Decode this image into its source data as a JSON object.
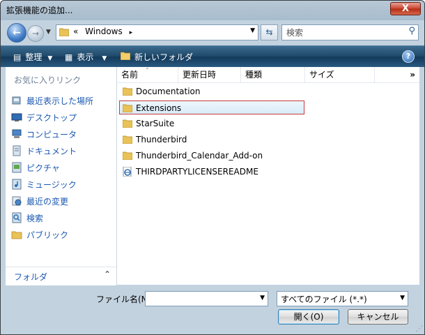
{
  "window": {
    "title": "拡張機能の追加...",
    "close_label": "X"
  },
  "address": {
    "prefix": "«",
    "crumb": "Windows",
    "sep": "▸"
  },
  "search": {
    "placeholder": "検索"
  },
  "toolbar": {
    "organize": "整理",
    "views": "表示",
    "new_folder": "新しいフォルダ",
    "help": "?"
  },
  "nav": {
    "header": "お気に入りリンク",
    "items": [
      {
        "label": "最近表示した場所",
        "icon": "recent-places-icon"
      },
      {
        "label": "デスクトップ",
        "icon": "desktop-icon"
      },
      {
        "label": "コンピュータ",
        "icon": "computer-icon"
      },
      {
        "label": "ドキュメント",
        "icon": "documents-icon"
      },
      {
        "label": "ピクチャ",
        "icon": "pictures-icon"
      },
      {
        "label": "ミュージック",
        "icon": "music-icon"
      },
      {
        "label": "最近の変更",
        "icon": "recently-changed-icon"
      },
      {
        "label": "検索",
        "icon": "searches-icon"
      },
      {
        "label": "パブリック",
        "icon": "public-folder-icon"
      }
    ],
    "folders_label": "フォルダ",
    "folders_chevron": "⌃"
  },
  "columns": [
    "名前",
    "更新日時",
    "種類",
    "サイズ"
  ],
  "columns_more": "»",
  "files": [
    {
      "name": "Documentation",
      "type": "folder",
      "selected": false
    },
    {
      "name": "Extensions",
      "type": "folder",
      "selected": true
    },
    {
      "name": "StarSuite",
      "type": "folder",
      "selected": false
    },
    {
      "name": "Thunderbird",
      "type": "folder",
      "selected": false
    },
    {
      "name": "Thunderbird_Calendar_Add-on",
      "type": "folder",
      "selected": false
    },
    {
      "name": "THIRDPARTYLICENSEREADME",
      "type": "html",
      "selected": false
    }
  ],
  "bottom": {
    "filename_label": "ファイル名(N):",
    "filename_value": "",
    "filetype_value": "すべてのファイル (*.*)",
    "open_label": "開く(O)",
    "cancel_label": "キャンセル"
  },
  "colors": {
    "link": "#1b58b0",
    "selection_border": "#c43a3a",
    "toolbar": "#1e4868"
  }
}
